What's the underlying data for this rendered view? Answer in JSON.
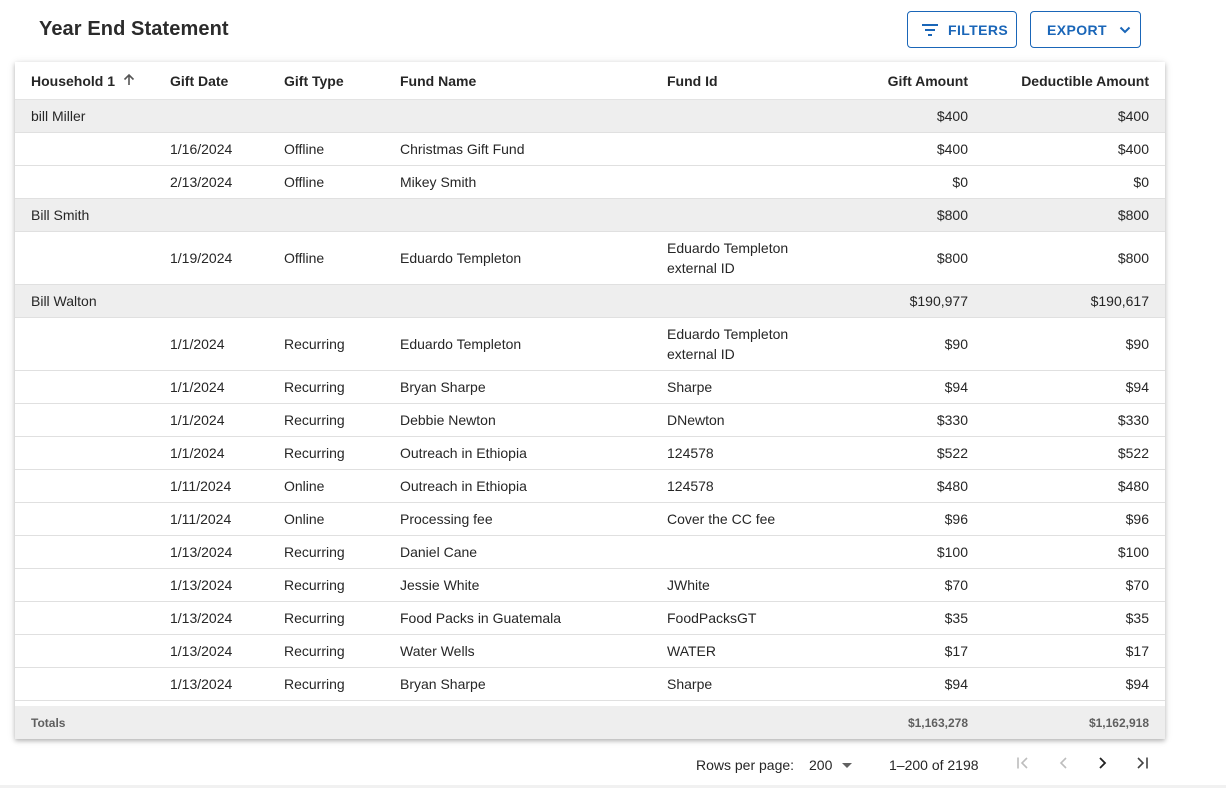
{
  "header": {
    "title": "Year End Statement",
    "filters_label": "FILTERS",
    "export_label": "EXPORT"
  },
  "table": {
    "columns": {
      "household": "Household 1",
      "gift_date": "Gift Date",
      "gift_type": "Gift Type",
      "fund_name": "Fund Name",
      "fund_id": "Fund Id",
      "gift_amount": "Gift Amount",
      "deductible_amount": "Deductible Amount"
    },
    "sort": {
      "column": "household",
      "direction": "ascending"
    },
    "rows": [
      {
        "kind": "group",
        "household": "bill Miller",
        "gift_amount": "$400",
        "deductible_amount": "$400"
      },
      {
        "kind": "detail",
        "gift_date": "1/16/2024",
        "gift_type": "Offline",
        "fund_name": "Christmas Gift Fund",
        "fund_id": "",
        "gift_amount": "$400",
        "deductible_amount": "$400"
      },
      {
        "kind": "detail",
        "gift_date": "2/13/2024",
        "gift_type": "Offline",
        "fund_name": "Mikey Smith",
        "fund_id": "",
        "gift_amount": "$0",
        "deductible_amount": "$0"
      },
      {
        "kind": "group",
        "household": "Bill Smith",
        "gift_amount": "$800",
        "deductible_amount": "$800"
      },
      {
        "kind": "detail",
        "tall": true,
        "gift_date": "1/19/2024",
        "gift_type": "Offline",
        "fund_name": "Eduardo Templeton",
        "fund_id": "Eduardo Templeton external ID",
        "gift_amount": "$800",
        "deductible_amount": "$800"
      },
      {
        "kind": "group",
        "household": "Bill Walton",
        "gift_amount": "$190,977",
        "deductible_amount": "$190,617"
      },
      {
        "kind": "detail",
        "tall": true,
        "gift_date": "1/1/2024",
        "gift_type": "Recurring",
        "fund_name": "Eduardo Templeton",
        "fund_id": "Eduardo Templeton external ID",
        "gift_amount": "$90",
        "deductible_amount": "$90"
      },
      {
        "kind": "detail",
        "gift_date": "1/1/2024",
        "gift_type": "Recurring",
        "fund_name": "Bryan Sharpe",
        "fund_id": "Sharpe",
        "gift_amount": "$94",
        "deductible_amount": "$94"
      },
      {
        "kind": "detail",
        "gift_date": "1/1/2024",
        "gift_type": "Recurring",
        "fund_name": "Debbie Newton",
        "fund_id": "DNewton",
        "gift_amount": "$330",
        "deductible_amount": "$330"
      },
      {
        "kind": "detail",
        "gift_date": "1/1/2024",
        "gift_type": "Recurring",
        "fund_name": "Outreach in Ethiopia",
        "fund_id": "124578",
        "gift_amount": "$522",
        "deductible_amount": "$522"
      },
      {
        "kind": "detail",
        "gift_date": "1/11/2024",
        "gift_type": "Online",
        "fund_name": "Outreach in Ethiopia",
        "fund_id": "124578",
        "gift_amount": "$480",
        "deductible_amount": "$480"
      },
      {
        "kind": "detail",
        "gift_date": "1/11/2024",
        "gift_type": "Online",
        "fund_name": "Processing fee",
        "fund_id": "Cover the CC fee",
        "gift_amount": "$96",
        "deductible_amount": "$96"
      },
      {
        "kind": "detail",
        "gift_date": "1/13/2024",
        "gift_type": "Recurring",
        "fund_name": "Daniel Cane",
        "fund_id": "",
        "gift_amount": "$100",
        "deductible_amount": "$100"
      },
      {
        "kind": "detail",
        "gift_date": "1/13/2024",
        "gift_type": "Recurring",
        "fund_name": "Jessie White",
        "fund_id": "JWhite",
        "gift_amount": "$70",
        "deductible_amount": "$70"
      },
      {
        "kind": "detail",
        "gift_date": "1/13/2024",
        "gift_type": "Recurring",
        "fund_name": "Food Packs in Guatemala",
        "fund_id": "FoodPacksGT",
        "gift_amount": "$35",
        "deductible_amount": "$35"
      },
      {
        "kind": "detail",
        "gift_date": "1/13/2024",
        "gift_type": "Recurring",
        "fund_name": "Water Wells",
        "fund_id": "WATER",
        "gift_amount": "$17",
        "deductible_amount": "$17"
      },
      {
        "kind": "detail",
        "gift_date": "1/13/2024",
        "gift_type": "Recurring",
        "fund_name": "Bryan Sharpe",
        "fund_id": "Sharpe",
        "gift_amount": "$94",
        "deductible_amount": "$94"
      }
    ],
    "totals": {
      "label": "Totals",
      "gift_amount": "$1,163,278",
      "deductible_amount": "$1,162,918"
    }
  },
  "pagination": {
    "rows_per_page_label": "Rows per page:",
    "rows_per_page": "200",
    "range": "1–200 of 2198"
  },
  "icons": {
    "filters": "filter-list-icon",
    "export": "chevron-down-icon",
    "sort": "arrow-up-icon",
    "rows_select": "caret-down-icon",
    "first_page": "first-page-icon",
    "prev_page": "chevron-left-icon",
    "next_page": "chevron-right-icon",
    "last_page": "last-page-icon"
  },
  "colors": {
    "accent": "#1a66b8",
    "group_row_bg": "#eeeeee",
    "disabled_icon": "#bdbdbd"
  }
}
